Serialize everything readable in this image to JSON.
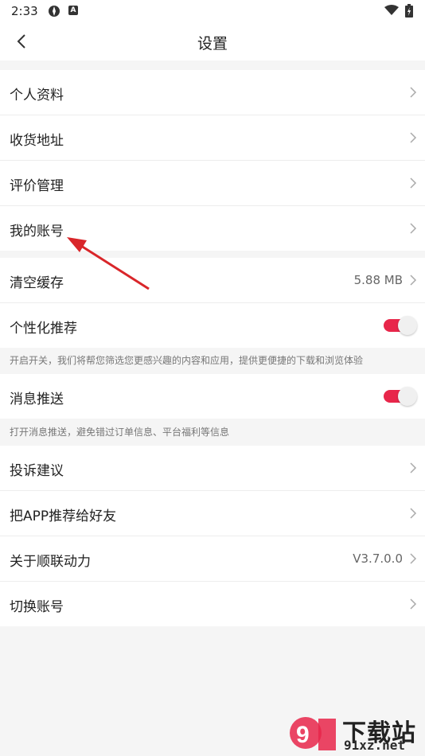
{
  "status": {
    "time": "2:33"
  },
  "header": {
    "title": "设置"
  },
  "groups": {
    "profile": [
      {
        "label": "个人资料"
      },
      {
        "label": "收货地址"
      },
      {
        "label": "评价管理"
      },
      {
        "label": "我的账号"
      }
    ],
    "cache": {
      "label": "清空缓存",
      "value": "5.88 MB"
    },
    "personalized": {
      "label": "个性化推荐",
      "enabled": true,
      "hint": "开启开关，我们将帮您筛选您更感兴趣的内容和应用，提供更便捷的下载和浏览体验"
    },
    "push": {
      "label": "消息推送",
      "enabled": true,
      "hint": "打开消息推送，避免错过订单信息、平台福利等信息"
    },
    "misc": [
      {
        "label": "投诉建议",
        "value": ""
      },
      {
        "label": "把APP推荐给好友",
        "value": ""
      },
      {
        "label": "关于顺联动力",
        "value": "V3.7.0.0"
      },
      {
        "label": "切换账号",
        "value": ""
      }
    ]
  },
  "watermark": {
    "text": "下载站",
    "url": "91xz.net"
  },
  "colors": {
    "accent": "#e8264a",
    "annotation_arrow": "#d9262a"
  }
}
